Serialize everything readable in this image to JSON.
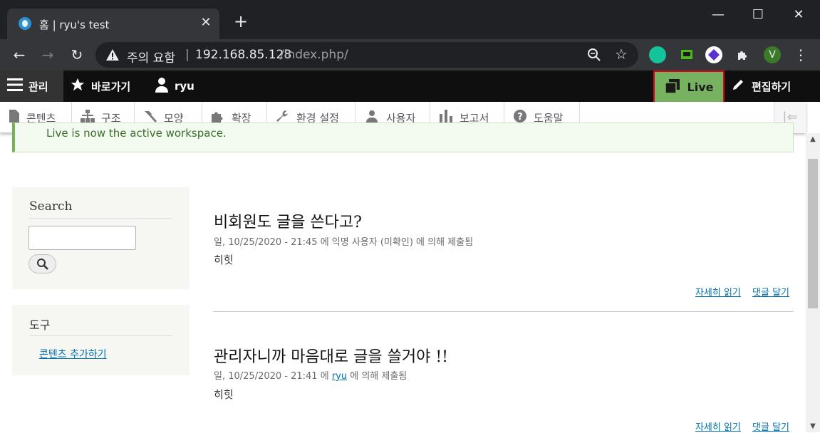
{
  "browser": {
    "tab_title": "홈 | ryu's test",
    "new_tab": "+",
    "window_controls": {
      "minimize": "—",
      "maximize": "☐",
      "close": "✕"
    },
    "security_label": "주의 요함",
    "separator": "|",
    "url_host": "192.168.85.128",
    "url_path": "/index.php/",
    "profile_initial": "V"
  },
  "admin_toolbar": {
    "manage": "관리",
    "shortcuts": "바로가기",
    "user": "ryu",
    "workspace": "Live",
    "edit": "편집하기"
  },
  "admin_tray": {
    "items": [
      "콘텐츠",
      "구조",
      "모양",
      "확장",
      "환경 설정",
      "사용자",
      "보고서",
      "도움말"
    ]
  },
  "status_message": "Live is now the active workspace.",
  "sidebar": {
    "search_title": "Search",
    "tools_title": "도구",
    "tools_link": "콘텐츠 추가하기"
  },
  "articles": [
    {
      "title": "비회원도 글을 쓴다고?",
      "meta_prefix": "일, 10/25/2020 - 21:45 에 익명 사용자 (미확인) 에 의해 제출됨",
      "body": "히힛",
      "read_more": "자세히 읽기",
      "comment": "댓글 달기"
    },
    {
      "title": "관리자니까 마음대로 글을 쓸거야 !!",
      "meta_prefix": "일, 10/25/2020 - 21:41 에",
      "author": "ryu",
      "meta_suffix": "에 의해 제출됨",
      "body": "히힛",
      "read_more": "자세히 읽기",
      "comment": "댓글 달기"
    }
  ],
  "colors": {
    "live_green": "#77b260",
    "highlight_red": "#e0001e",
    "link_blue": "#0071b3"
  }
}
